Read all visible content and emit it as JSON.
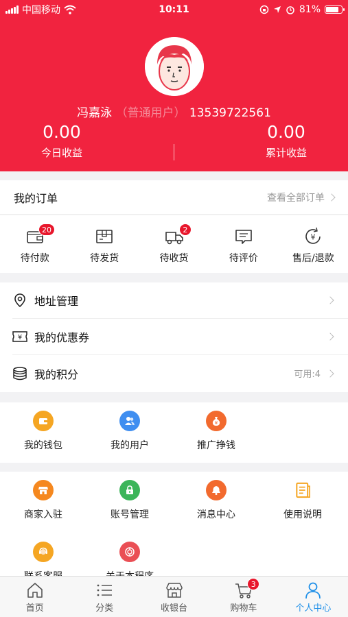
{
  "status_bar": {
    "carrier": "中国移动",
    "time": "10:11",
    "battery_percent": "81%",
    "battery_level": 0.81
  },
  "profile": {
    "name": "冯嘉泳",
    "role": "（普通用户）",
    "phone": "13539722561",
    "today_value": "0.00",
    "today_label": "今日收益",
    "total_value": "0.00",
    "total_label": "累计收益"
  },
  "orders": {
    "title": "我的订单",
    "view_all": "查看全部订单",
    "items": [
      {
        "label": "待付款",
        "badge": "20",
        "icon": "wallet-icon"
      },
      {
        "label": "待发货",
        "badge": "",
        "icon": "box-icon"
      },
      {
        "label": "待收货",
        "badge": "2",
        "icon": "truck-icon"
      },
      {
        "label": "待评价",
        "badge": "",
        "icon": "comment-icon"
      },
      {
        "label": "售后/退款",
        "badge": "",
        "icon": "refund-icon"
      }
    ]
  },
  "menu": {
    "address": "地址管理",
    "coupons": "我的优惠券",
    "points": "我的积分",
    "points_extra": "可用:4"
  },
  "shortcuts": [
    {
      "label": "我的钱包",
      "icon": "wallet-icon",
      "color": "#f5a623"
    },
    {
      "label": "我的用户",
      "icon": "users-icon",
      "color": "#3f8ef0"
    },
    {
      "label": "推广挣钱",
      "icon": "money-bag-icon",
      "color": "#f26a2e"
    }
  ],
  "services": [
    {
      "label": "商家入驻",
      "icon": "store-icon",
      "color": "#f5881f"
    },
    {
      "label": "账号管理",
      "icon": "lock-icon",
      "color": "#3cb55a"
    },
    {
      "label": "消息中心",
      "icon": "bell-icon",
      "color": "#f26a2e"
    },
    {
      "label": "使用说明",
      "icon": "document-icon",
      "color": "#f5a623"
    },
    {
      "label": "联系客服",
      "icon": "service-icon",
      "color": "#f5a623"
    },
    {
      "label": "关于本程序",
      "icon": "about-icon",
      "color": "#ea4f55"
    }
  ],
  "tabbar": {
    "items": [
      {
        "label": "首页",
        "icon": "home-icon"
      },
      {
        "label": "分类",
        "icon": "list-icon"
      },
      {
        "label": "收银台",
        "icon": "store-front-icon"
      },
      {
        "label": "购物车",
        "icon": "cart-icon",
        "badge": "3"
      },
      {
        "label": "个人中心",
        "icon": "person-icon",
        "active": true
      }
    ]
  },
  "colors": {
    "brand_red": "#f1233f",
    "active_blue": "#1e8fe8",
    "badge_red": "#e8172c"
  }
}
